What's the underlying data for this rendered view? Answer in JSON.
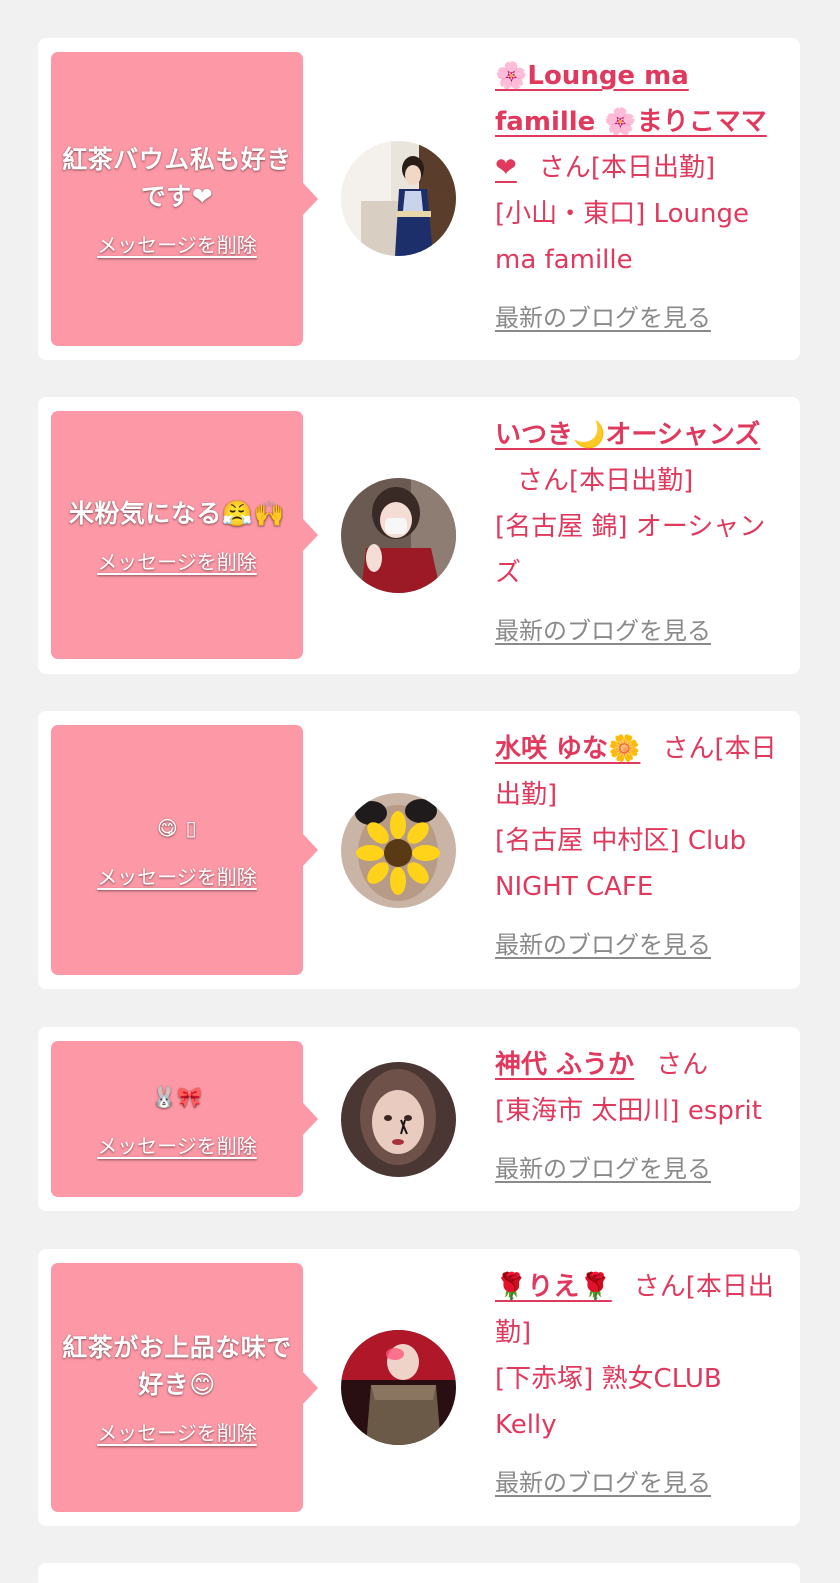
{
  "cards": [
    {
      "message": "紅茶バウム私も好きです❤",
      "delete_label": "メッセージを削除",
      "name": "🌸Lounge ma famille 🌸まりこママ❤",
      "honorific": "さん",
      "status": "[本日出勤]",
      "shop": "[小山・東口] Lounge ma famille",
      "blog_label": "最新のブログを見る"
    },
    {
      "message": "米粉気になる😤🙌",
      "delete_label": "メッセージを削除",
      "name": "いつき🌙オーシャンズ",
      "honorific": "さん",
      "status": "[本日出勤]",
      "shop": "[名古屋 錦] オーシャンズ",
      "blog_label": "最新のブログを見る"
    },
    {
      "message": "😋 ▯",
      "delete_label": "メッセージを削除",
      "name": "水咲 ゆな🌼",
      "honorific": "さん",
      "status": "[本日出勤]",
      "shop": "[名古屋 中村区] Club NIGHT CAFE",
      "blog_label": "最新のブログを見る"
    },
    {
      "message": "🐰🎀",
      "delete_label": "メッセージを削除",
      "name": "神代 ふうか",
      "honorific": "さん",
      "status": "",
      "shop": "[東海市 太田川] esprit",
      "blog_label": "最新のブログを見る"
    },
    {
      "message": "紅茶がお上品な味で好き😊",
      "delete_label": "メッセージを削除",
      "name": "🌹りえ🌹",
      "honorific": "さん",
      "status": "[本日出勤]",
      "shop": "[下赤塚] 熟女CLUB Kelly",
      "blog_label": "最新のブログを見る"
    }
  ],
  "colors": {
    "page_bg": "#f1f1f1",
    "bubble": "#fd98a6",
    "accent": "#e0395e",
    "blog_link": "#8a8a8a"
  }
}
